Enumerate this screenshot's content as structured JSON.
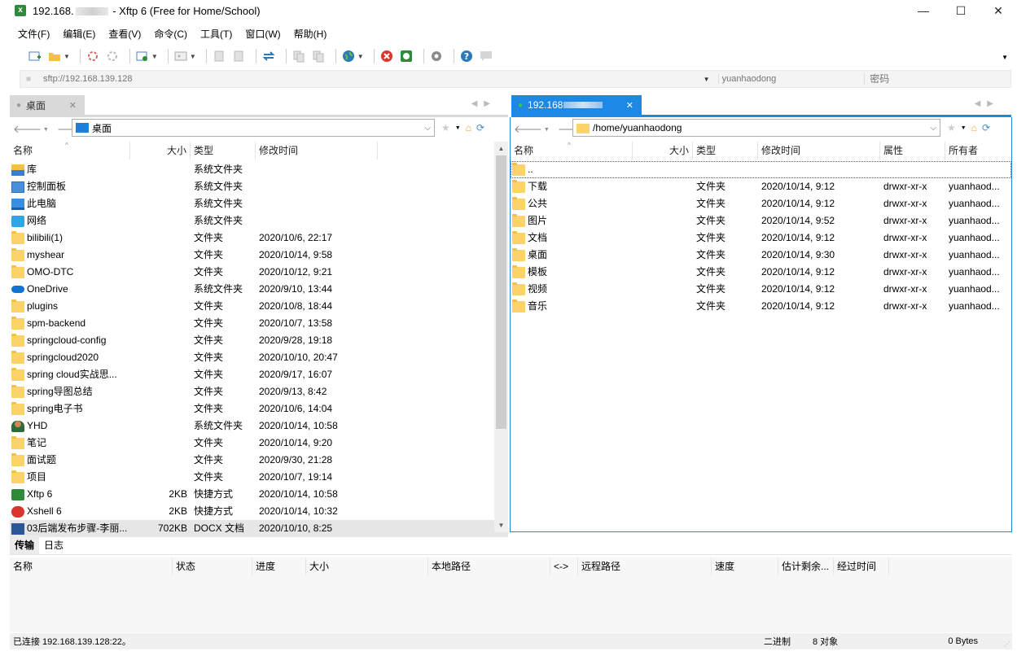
{
  "window": {
    "title_prefix": "192.168.",
    "title_suffix": " - Xftp 6 (Free for Home/School)",
    "minimize": "—",
    "maximize": "☐",
    "close": "✕"
  },
  "menu": [
    "文件(F)",
    "编辑(E)",
    "查看(V)",
    "命令(C)",
    "工具(T)",
    "窗口(W)",
    "帮助(H)"
  ],
  "address": {
    "url": "sftp://192.168.139.128",
    "username_placeholder": "yuanhaodong",
    "password_placeholder": "密码"
  },
  "left_pane": {
    "tab_label": "桌面",
    "path": "桌面",
    "columns": [
      "名称",
      "大小",
      "类型",
      "修改时间"
    ],
    "rows": [
      {
        "name": "库",
        "size": "",
        "type": "系统文件夹",
        "mtime": "",
        "icon": "library-icon"
      },
      {
        "name": "控制面板",
        "size": "",
        "type": "系统文件夹",
        "mtime": "",
        "icon": "control-panel-icon"
      },
      {
        "name": "此电脑",
        "size": "",
        "type": "系统文件夹",
        "mtime": "",
        "icon": "computer-icon"
      },
      {
        "name": "网络",
        "size": "",
        "type": "系统文件夹",
        "mtime": "",
        "icon": "network-icon"
      },
      {
        "name": "bilibili(1)",
        "size": "",
        "type": "文件夹",
        "mtime": "2020/10/6, 22:17",
        "icon": "folder-icon"
      },
      {
        "name": "myshear",
        "size": "",
        "type": "文件夹",
        "mtime": "2020/10/14, 9:58",
        "icon": "folder-icon"
      },
      {
        "name": "OMO-DTC",
        "size": "",
        "type": "文件夹",
        "mtime": "2020/10/12, 9:21",
        "icon": "folder-icon"
      },
      {
        "name": "OneDrive",
        "size": "",
        "type": "系统文件夹",
        "mtime": "2020/9/10, 13:44",
        "icon": "onedrive-icon"
      },
      {
        "name": "plugins",
        "size": "",
        "type": "文件夹",
        "mtime": "2020/10/8, 18:44",
        "icon": "folder-icon"
      },
      {
        "name": "spm-backend",
        "size": "",
        "type": "文件夹",
        "mtime": "2020/10/7, 13:58",
        "icon": "folder-icon"
      },
      {
        "name": "springcloud-config",
        "size": "",
        "type": "文件夹",
        "mtime": "2020/9/28, 19:18",
        "icon": "folder-icon"
      },
      {
        "name": "springcloud2020",
        "size": "",
        "type": "文件夹",
        "mtime": "2020/10/10, 20:47",
        "icon": "folder-icon"
      },
      {
        "name": "spring cloud实战思...",
        "size": "",
        "type": "文件夹",
        "mtime": "2020/9/17, 16:07",
        "icon": "folder-icon"
      },
      {
        "name": "spring导图总结",
        "size": "",
        "type": "文件夹",
        "mtime": "2020/9/13, 8:42",
        "icon": "folder-icon"
      },
      {
        "name": "spring电子书",
        "size": "",
        "type": "文件夹",
        "mtime": "2020/10/6, 14:04",
        "icon": "folder-icon"
      },
      {
        "name": "YHD",
        "size": "",
        "type": "系统文件夹",
        "mtime": "2020/10/14, 10:58",
        "icon": "user-folder-icon"
      },
      {
        "name": "笔记",
        "size": "",
        "type": "文件夹",
        "mtime": "2020/10/14, 9:20",
        "icon": "folder-icon"
      },
      {
        "name": "面试题",
        "size": "",
        "type": "文件夹",
        "mtime": "2020/9/30, 21:28",
        "icon": "folder-icon"
      },
      {
        "name": "项目",
        "size": "",
        "type": "文件夹",
        "mtime": "2020/10/7, 19:14",
        "icon": "folder-icon"
      },
      {
        "name": "Xftp 6",
        "size": "2KB",
        "type": "快捷方式",
        "mtime": "2020/10/14, 10:58",
        "icon": "xftp-shortcut-icon"
      },
      {
        "name": "Xshell 6",
        "size": "2KB",
        "type": "快捷方式",
        "mtime": "2020/10/14, 10:32",
        "icon": "xshell-shortcut-icon"
      },
      {
        "name": "03后端发布步骤-李丽...",
        "size": "702KB",
        "type": "DOCX 文档",
        "mtime": "2020/10/10, 8:25",
        "icon": "docx-icon"
      }
    ]
  },
  "right_pane": {
    "tab_label": "192.168",
    "path": "/home/yuanhaodong",
    "columns": [
      "名称",
      "大小",
      "类型",
      "修改时间",
      "属性",
      "所有者"
    ],
    "rows": [
      {
        "name": "..",
        "size": "",
        "type": "",
        "mtime": "",
        "attr": "",
        "owner": ""
      },
      {
        "name": "下载",
        "size": "",
        "type": "文件夹",
        "mtime": "2020/10/14, 9:12",
        "attr": "drwxr-xr-x",
        "owner": "yuanhaod..."
      },
      {
        "name": "公共",
        "size": "",
        "type": "文件夹",
        "mtime": "2020/10/14, 9:12",
        "attr": "drwxr-xr-x",
        "owner": "yuanhaod..."
      },
      {
        "name": "图片",
        "size": "",
        "type": "文件夹",
        "mtime": "2020/10/14, 9:52",
        "attr": "drwxr-xr-x",
        "owner": "yuanhaod..."
      },
      {
        "name": "文档",
        "size": "",
        "type": "文件夹",
        "mtime": "2020/10/14, 9:12",
        "attr": "drwxr-xr-x",
        "owner": "yuanhaod..."
      },
      {
        "name": "桌面",
        "size": "",
        "type": "文件夹",
        "mtime": "2020/10/14, 9:30",
        "attr": "drwxr-xr-x",
        "owner": "yuanhaod..."
      },
      {
        "name": "模板",
        "size": "",
        "type": "文件夹",
        "mtime": "2020/10/14, 9:12",
        "attr": "drwxr-xr-x",
        "owner": "yuanhaod..."
      },
      {
        "name": "视频",
        "size": "",
        "type": "文件夹",
        "mtime": "2020/10/14, 9:12",
        "attr": "drwxr-xr-x",
        "owner": "yuanhaod..."
      },
      {
        "name": "音乐",
        "size": "",
        "type": "文件夹",
        "mtime": "2020/10/14, 9:12",
        "attr": "drwxr-xr-x",
        "owner": "yuanhaod..."
      }
    ]
  },
  "bottom": {
    "tabs": [
      "传输",
      "日志"
    ],
    "columns": [
      "名称",
      "状态",
      "进度",
      "大小",
      "本地路径",
      "<->",
      "远程路径",
      "速度",
      "估计剩余...",
      "经过时间"
    ]
  },
  "status": {
    "connection": "已连接 192.168.139.128:22。",
    "mode": "二进制",
    "count": "8 对象",
    "bytes": "0 Bytes"
  },
  "colors": {
    "accent": "#1e88e5",
    "folder": "#fcd26b",
    "xftp_green": "#2e8b3a"
  }
}
